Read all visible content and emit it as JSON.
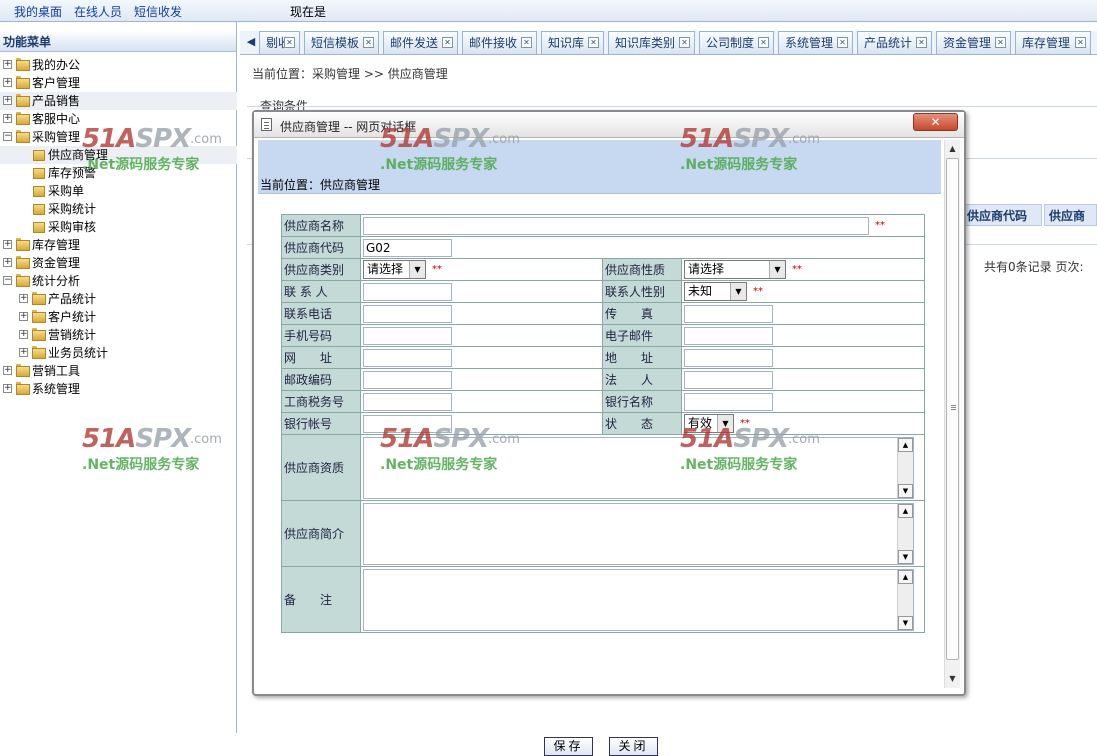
{
  "topbar": {
    "links": [
      "我的桌面",
      "在线人员",
      "短信收发"
    ],
    "status_text": "现在是"
  },
  "sidebar": {
    "title": "功能菜单",
    "tree": [
      {
        "label": "我的办公",
        "level": 0,
        "expanded": false
      },
      {
        "label": "客户管理",
        "level": 0,
        "expanded": false
      },
      {
        "label": "产品销售",
        "level": 0,
        "expanded": false
      },
      {
        "label": "客服中心",
        "level": 0,
        "expanded": false
      },
      {
        "label": "采购管理",
        "level": 0,
        "expanded": true
      },
      {
        "label": "供应商管理",
        "level": 1
      },
      {
        "label": "库存预警",
        "level": 1
      },
      {
        "label": "采购单",
        "level": 1
      },
      {
        "label": "采购统计",
        "level": 1
      },
      {
        "label": "采购审核",
        "level": 1
      },
      {
        "label": "库存管理",
        "level": 0,
        "expanded": false
      },
      {
        "label": "资金管理",
        "level": 0,
        "expanded": false
      },
      {
        "label": "统计分析",
        "level": 0,
        "expanded": true
      },
      {
        "label": "产品统计",
        "level": 1,
        "expanded": false
      },
      {
        "label": "客户统计",
        "level": 1,
        "expanded": false
      },
      {
        "label": "营销统计",
        "level": 1,
        "expanded": false
      },
      {
        "label": "业务员统计",
        "level": 1,
        "expanded": false
      },
      {
        "label": "营销工具",
        "level": 0,
        "expanded": false
      },
      {
        "label": "系统管理",
        "level": 0,
        "expanded": false
      }
    ]
  },
  "tabs": [
    "剔收",
    "短信模板",
    "邮件发送",
    "邮件接收",
    "知识库",
    "知识库类别",
    "公司制度",
    "系统管理",
    "产品统计",
    "资金管理",
    "库存管理"
  ],
  "main": {
    "breadcrumb": "当前位置：采购管理 >> 供应商管理",
    "query_label": "查询条件",
    "col_supplier_code": "供应商代码",
    "col_supplier_name": "供应商",
    "records": "共有0条记录  页次:"
  },
  "dialog": {
    "title": "供应商管理 -- 网页对话框",
    "close_label": "✕",
    "breadcrumb": "当前位置：供应商管理",
    "fields": {
      "name_label": "供应商名称",
      "name_value": "",
      "code_label": "供应商代码",
      "code_value": "G02",
      "type_label": "供应商类别",
      "type_value": "请选择",
      "nature_label": "供应商性质",
      "nature_value": "请选择",
      "contact_label": "联 系 人",
      "contact_value": "",
      "gender_label": "联系人性别",
      "gender_value": "未知",
      "phone_label": "联系电话",
      "phone_value": "",
      "fax_label": "传　　真",
      "fax_value": "",
      "mobile_label": "手机号码",
      "mobile_value": "",
      "email_label": "电子邮件",
      "email_value": "",
      "website_label": "网　　址",
      "website_value": "",
      "address_label": "地　　址",
      "address_value": "",
      "postcode_label": "邮政编码",
      "postcode_value": "",
      "legal_label": "法　　人",
      "legal_value": "",
      "tax_label": "工商税务号",
      "tax_value": "",
      "bank_label": "银行名称",
      "bank_value": "",
      "account_label": "银行帐号",
      "account_value": "",
      "status_label": "状　　态",
      "status_value": "有效",
      "qualification_label": "供应商资质",
      "intro_label": "供应商简介",
      "remark_label": "备　　注",
      "required_mark": "**"
    },
    "save_label": "保存",
    "close_button_label": "关闭"
  },
  "watermark": {
    "brand_a": "51A",
    "brand_b": "SPX",
    "domain": ".com",
    "slogan": ".Net源码服务专家"
  }
}
